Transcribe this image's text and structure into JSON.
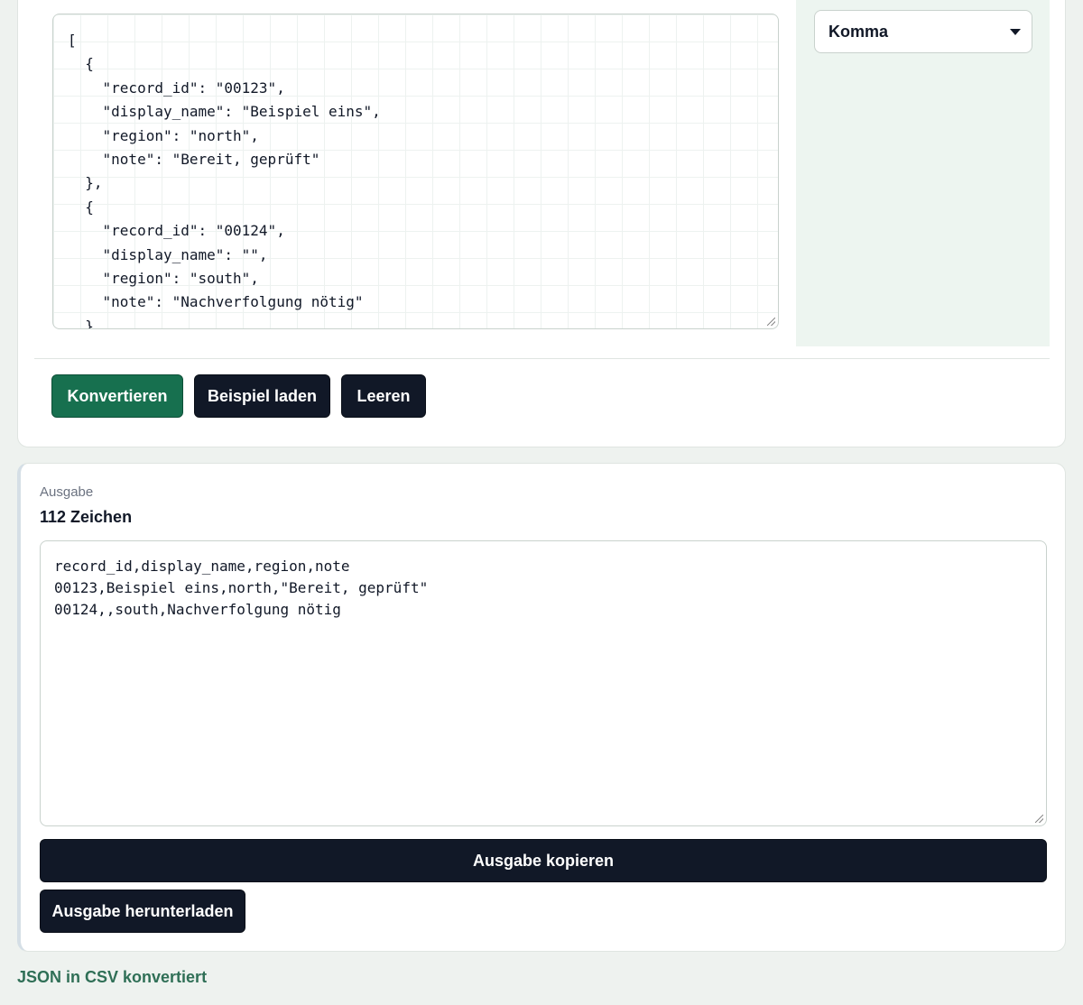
{
  "input": {
    "code_lines": [
      "[",
      "  {",
      "    \"record_id\": \"00123\",",
      "    \"display_name\": \"Beispiel eins\",",
      "    \"region\": \"north\",",
      "    \"note\": \"Bereit, geprüft\"",
      "  },",
      "  {",
      "    \"record_id\": \"00124\",",
      "    \"display_name\": \"\",",
      "    \"region\": \"south\",",
      "    \"note\": \"Nachverfolgung nötig\"",
      "  }"
    ]
  },
  "delimiter": {
    "selected": "Komma"
  },
  "actions": {
    "convert_label": "Konvertieren",
    "load_example_label": "Beispiel laden",
    "clear_label": "Leeren"
  },
  "output": {
    "label": "Ausgabe",
    "char_count": "112 Zeichen",
    "lines": [
      "record_id,display_name,region,note",
      "00123,Beispiel eins,north,\"Bereit, geprüft\"",
      "00124,,south,Nachverfolgung nötig"
    ],
    "copy_label": "Ausgabe kopieren",
    "download_label": "Ausgabe herunterladen"
  },
  "status": {
    "message": "JSON in CSV konvertiert"
  },
  "colors": {
    "primary": "#17704f",
    "dark": "#111827",
    "status_text": "#2f6f56",
    "page_bg": "#eef2ef"
  }
}
